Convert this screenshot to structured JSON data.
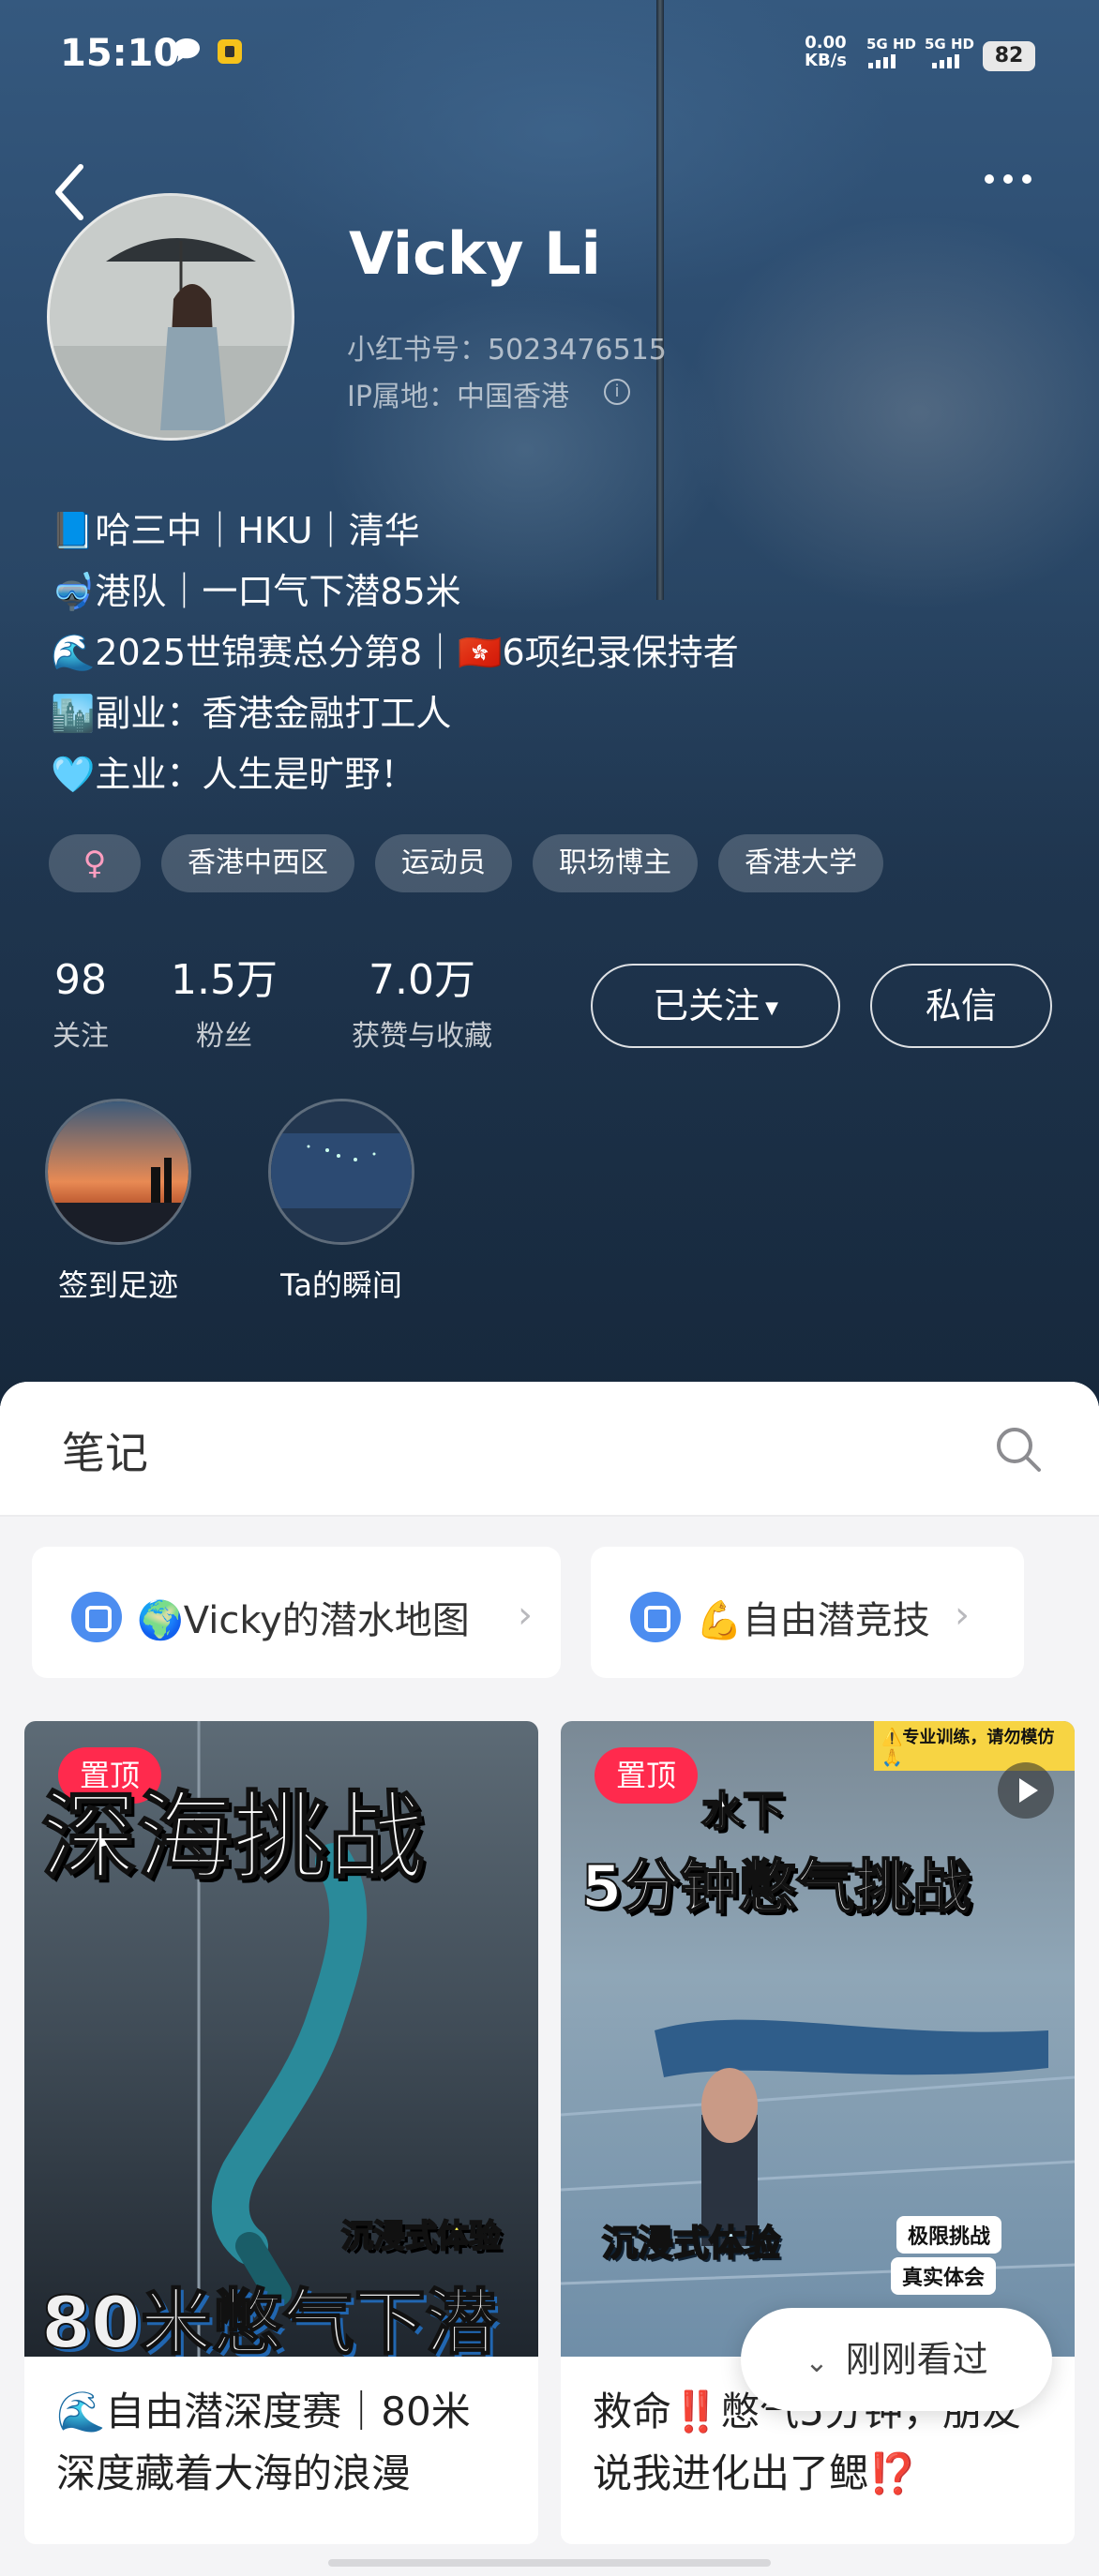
{
  "status_bar": {
    "time": "15:10",
    "net_speed_value": "0.00",
    "net_speed_unit": "KB/s",
    "sim1": "5G HD",
    "sim2": "5G HD",
    "battery": "82"
  },
  "profile": {
    "name": "Vicky Li",
    "red_id": "小红书号：5023476515",
    "ip_location": "IP属地：中国香港",
    "bio": [
      {
        "icon": "📘",
        "text": "哈三中｜HKU｜清华"
      },
      {
        "icon": "🤿",
        "text": "港队｜一口气下潜85米"
      },
      {
        "icon": "🌊",
        "text": "2025世锦赛总分第8｜🇭🇰6项纪录保持者"
      },
      {
        "icon": "🏙️",
        "text": "副业：香港金融打工人"
      },
      {
        "icon": "🩵",
        "text": "主业：人生是旷野！"
      }
    ],
    "tags": {
      "gender": "♀",
      "items": [
        "香港中西区",
        "运动员",
        "职场博主",
        "香港大学"
      ]
    },
    "stats": [
      {
        "value": "98",
        "label": "关注"
      },
      {
        "value": "1.5万",
        "label": "粉丝"
      },
      {
        "value": "7.0万",
        "label": "获赞与收藏"
      }
    ],
    "follow_button": "已关注",
    "message_button": "私信",
    "highlights": [
      {
        "label": "签到足迹"
      },
      {
        "label": "Ta的瞬间"
      }
    ]
  },
  "notes": {
    "tab_title": "笔记",
    "collections": [
      {
        "label": "🌍Vicky的潜水地图"
      },
      {
        "label": "💪自由潜竞技"
      }
    ],
    "cards": [
      {
        "pinned_label": "置顶",
        "cover_headline": "深海挑战",
        "cover_caption": "沉浸式体验",
        "cover_bottom": "80米憋气下潜",
        "title": "🌊自由潜深度赛｜80米深度藏着大海的浪漫"
      },
      {
        "pinned_label": "置顶",
        "cover_ribbon": "⚠️专业训练，请勿模仿🙏",
        "cover_top": "水下",
        "cover_headline": "5分钟憋气挑战",
        "cover_caption": "沉浸式体验",
        "sticker1": "极限挑战",
        "sticker2": "真实体会",
        "title": "救命‼️憋气5分钟，朋友说我进化出了鳃⁉️"
      }
    ],
    "recently_viewed": "刚刚看过"
  }
}
